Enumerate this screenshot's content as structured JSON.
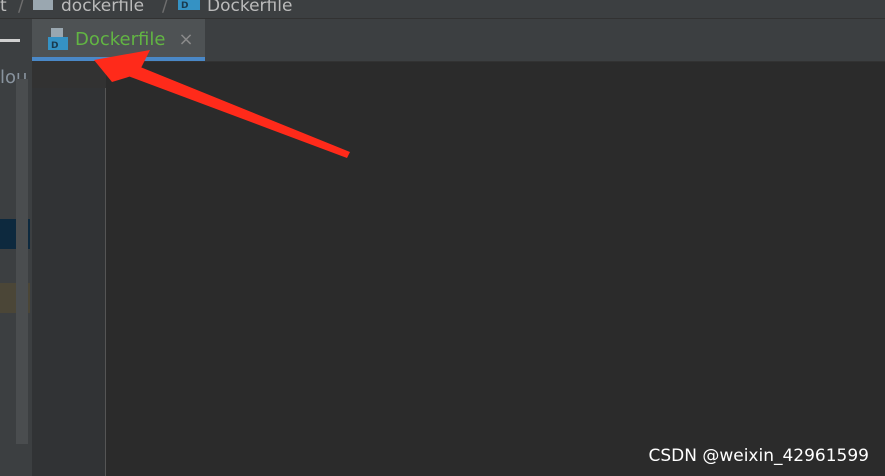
{
  "breadcrumb": {
    "items": [
      {
        "label": "t",
        "icon": "folder-icon"
      },
      {
        "label": "dockerfile",
        "icon": "folder-icon"
      },
      {
        "label": "Dockerfile",
        "icon": "dockerfile-icon"
      }
    ],
    "separator": "/"
  },
  "project_panel": {
    "visible_text": "lou"
  },
  "tabs": [
    {
      "label": "Dockerfile",
      "icon": "dockerfile-icon",
      "close": "×",
      "active": true,
      "color": "#62b543"
    }
  ],
  "editor": {
    "content": ""
  },
  "annotation": {
    "shape": "red-arrow",
    "color": "#ff2a1a",
    "points_to": "tab-dockerfile"
  },
  "watermark": "CSDN @weixin_42961599",
  "colors": {
    "background": "#2b2b2b",
    "panel": "#3c3f41",
    "tab_active": "#4e5254",
    "tab_underline": "#4a88c7",
    "modified_file_green": "#62b543"
  }
}
